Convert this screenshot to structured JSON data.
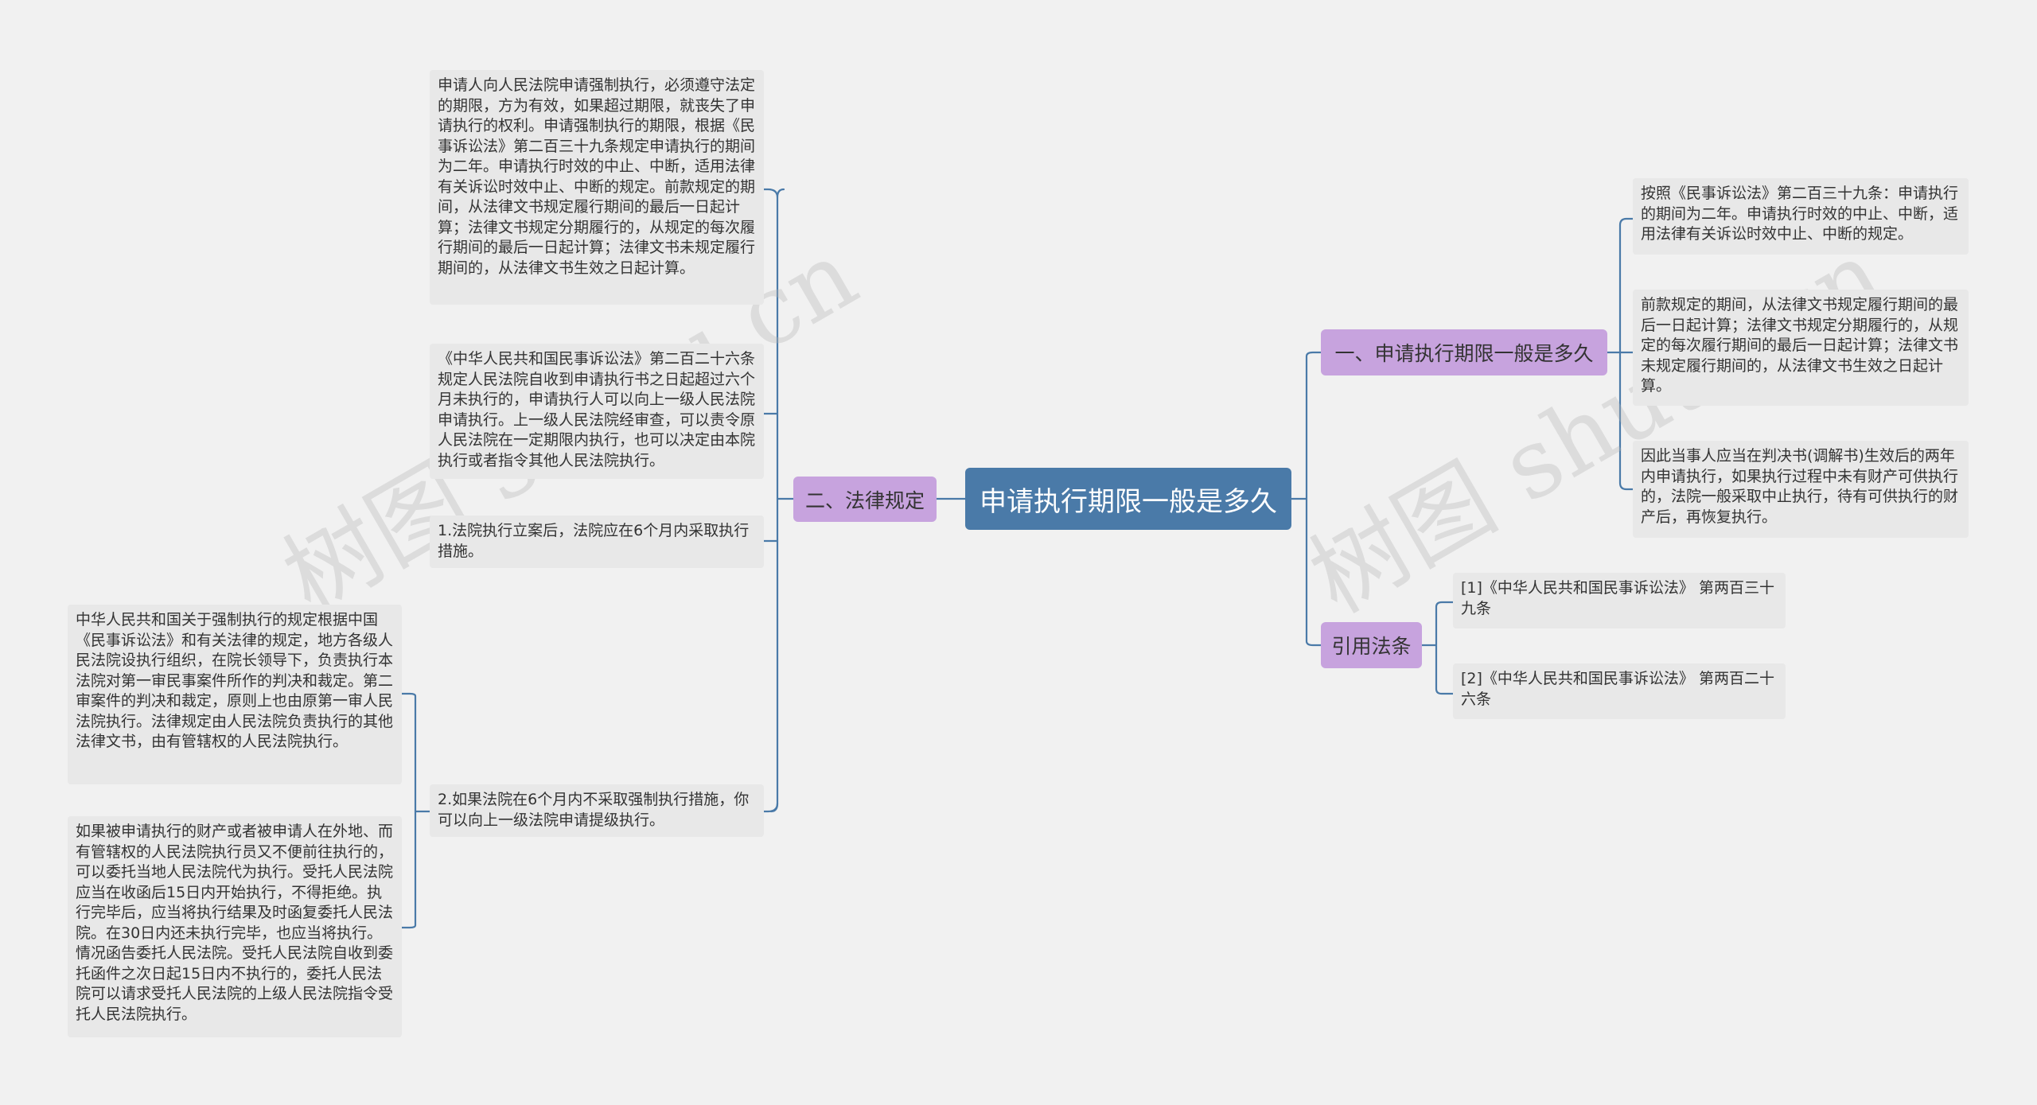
{
  "root": {
    "label": "申请执行期限一般是多久"
  },
  "left_branch": {
    "label": "二、法律规定",
    "leaves": [
      {
        "text": "申请人向人民法院申请强制执行，必须遵守法定的期限，方为有效，如果超过期限，就丧失了申请执行的权利。申请强制执行的期限，根据《民事诉讼法》第二百三十九条规定申请执行的期间为二年。申请执行时效的中止、中断，适用法律有关诉讼时效中止、中断的规定。前款规定的期间，从法律文书规定履行期间的最后一日起计算；法律文书规定分期履行的，从规定的每次履行期间的最后一日起计算；法律文书未规定履行期间的，从法律文书生效之日起计算。"
      },
      {
        "text": "《中华人民共和国民事诉讼法》第二百二十六条规定人民法院自收到申请执行书之日起超过六个月未执行的，申请执行人可以向上一级人民法院申请执行。上一级人民法院经审查，可以责令原人民法院在一定期限内执行，也可以决定由本院执行或者指令其他人民法院执行。"
      },
      {
        "text": "1.法院执行立案后，法院应在6个月内采取执行措施。"
      },
      {
        "text": "2.如果法院在6个月内不采取强制执行措施，你可以向上一级法院申请提级执行。",
        "children": [
          {
            "text": "中华人民共和国关于强制执行的规定根据中国《民事诉讼法》和有关法律的规定，地方各级人民法院设执行组织，在院长领导下，负责执行本法院对第一审民事案件所作的判决和裁定。第二审案件的判决和裁定，原则上也由原第一审人民法院执行。法律规定由人民法院负责执行的其他法律文书，由有管辖权的人民法院执行。"
          },
          {
            "text": "如果被申请执行的财产或者被申请人在外地、而有管辖权的人民法院执行员又不便前往执行的，可以委托当地人民法院代为执行。受托人民法院应当在收函后15日内开始执行，不得拒绝。执行完毕后，应当将执行结果及时函复委托人民法院。在30日内还未执行完毕，也应当将执行。情况函告委托人民法院。受托人民法院自收到委托函件之次日起15日内不执行的，委托人民法院可以请求受托人民法院的上级人民法院指令受托人民法院执行。"
          }
        ]
      }
    ]
  },
  "right_branch_1": {
    "label": "一、申请执行期限一般是多久",
    "leaves": [
      {
        "text": "按照《民事诉讼法》第二百三十九条：申请执行的期间为二年。申请执行时效的中止、中断，适用法律有关诉讼时效中止、中断的规定。"
      },
      {
        "text": "前款规定的期间，从法律文书规定履行期间的最后一日起计算；法律文书规定分期履行的，从规定的每次履行期间的最后一日起计算；法律文书未规定履行期间的，从法律文书生效之日起计算。"
      },
      {
        "text": "因此当事人应当在判决书(调解书)生效后的两年内申请执行，如果执行过程中未有财产可供执行的，法院一般采取中止执行，待有可供执行的财产后，再恢复执行。"
      }
    ]
  },
  "right_branch_2": {
    "label": "引用法条",
    "leaves": [
      {
        "text": "[1]《中华人民共和国民事诉讼法》 第两百三十九条"
      },
      {
        "text": "[2]《中华人民共和国民事诉讼法》 第两百二十六条"
      }
    ]
  },
  "watermark": {
    "text": "树图 shutu.cn"
  },
  "colors": {
    "root": "#4a7aa8",
    "branch": "#c7a3de",
    "leaf": "#e8e8e8",
    "line": "#4a7aa8",
    "background": "#f1f1f1"
  }
}
